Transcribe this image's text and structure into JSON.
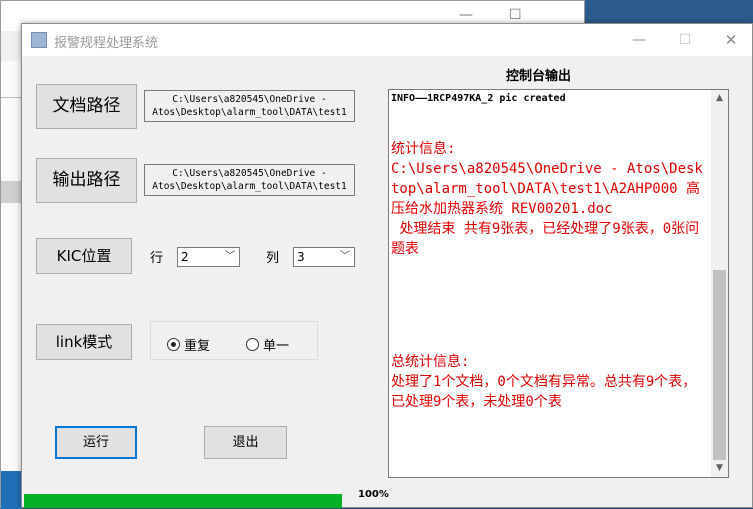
{
  "window": {
    "title": "报警规程处理系统",
    "minimize": "—",
    "maximize": "☐",
    "close": "✕"
  },
  "doc_path": {
    "button_label": "文档路径",
    "value": "C:\\Users\\a820545\\OneDrive -\nAtos\\Desktop\\alarm_tool\\DATA\\test1"
  },
  "output_path": {
    "button_label": "输出路径",
    "value": "C:\\Users\\a820545\\OneDrive -\nAtos\\Desktop\\alarm_tool\\DATA\\test1"
  },
  "kic": {
    "button_label": "KIC位置",
    "row_label": "行",
    "row_value": "2",
    "col_label": "列",
    "col_value": "3"
  },
  "link_mode": {
    "button_label": "link模式",
    "options": [
      "重复",
      "单一"
    ],
    "selected": "重复"
  },
  "actions": {
    "run": "运行",
    "exit": "退出"
  },
  "console": {
    "title": "控制台输出",
    "first_line": "INFO——1RCP497KA_2 pic created",
    "stats": "统计信息:\nC:\\Users\\a820545\\OneDrive - Atos\\Desktop\\alarm_tool\\DATA\\test1\\A2AHP000 高压给水加热器系统 REV00201.doc\n 处理结束 共有9张表，已经处理了9张表，0张问题表",
    "total_stats": "总统计信息:\n处理了1个文档，0个文档有异常。总共有9个表，已处理9个表，未处理0个表"
  },
  "progress": {
    "percent": 100,
    "label": "100%"
  }
}
